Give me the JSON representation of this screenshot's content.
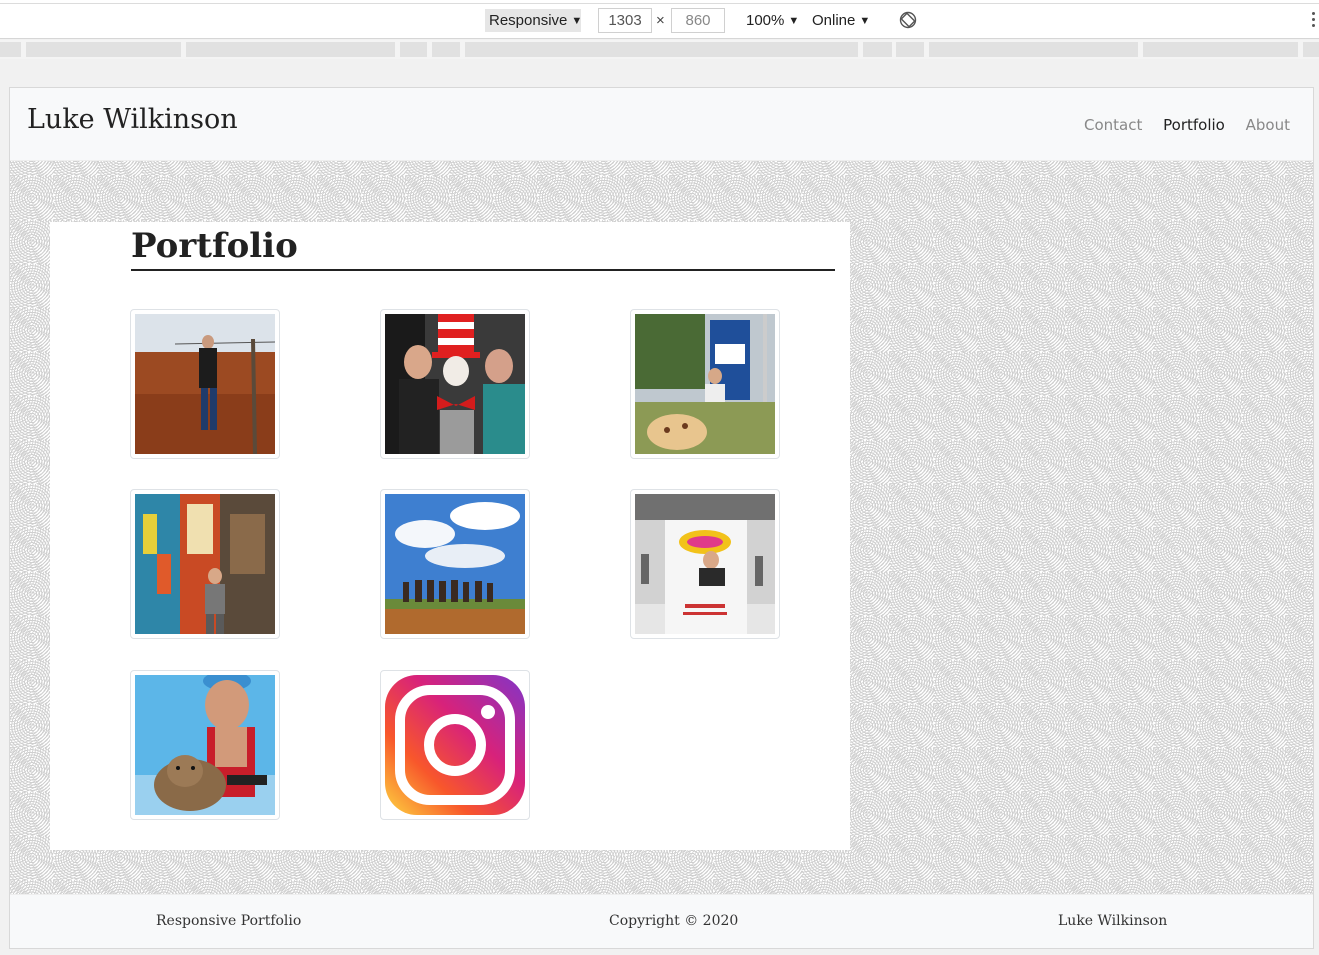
{
  "devtools": {
    "device_label": "Responsive",
    "width_value": "1303",
    "height_value": "860",
    "times": "×",
    "zoom_label": "100%",
    "network_label": "Online",
    "caret": "▼"
  },
  "site": {
    "brand": "Luke Wilkinson",
    "nav": [
      {
        "label": "Contact",
        "active": false
      },
      {
        "label": "Portfolio",
        "active": true
      },
      {
        "label": "About",
        "active": false
      }
    ],
    "page_title": "Portfolio",
    "gallery": [
      {
        "name": "photo-outback-fence",
        "icon": "outback-photo"
      },
      {
        "name": "photo-cat-in-the-hat",
        "icon": "costume-photo"
      },
      {
        "name": "photo-sign-selfie",
        "icon": "sign-photo"
      },
      {
        "name": "photo-mural-wall",
        "icon": "mural-photo"
      },
      {
        "name": "photo-easter-island",
        "icon": "moai-photo"
      },
      {
        "name": "photo-qantas-board",
        "icon": "airport-photo"
      },
      {
        "name": "photo-quokka-selfie",
        "icon": "quokka-photo"
      },
      {
        "name": "instagram-logo",
        "icon": "instagram-icon"
      }
    ],
    "footer": {
      "left": "Responsive Portfolio",
      "center": "Copyright © 2020",
      "right": "Luke Wilkinson"
    }
  },
  "colors": {
    "navbar_bg": "#f8f9fa",
    "text_dark": "#222222",
    "nav_muted": "#888888"
  }
}
